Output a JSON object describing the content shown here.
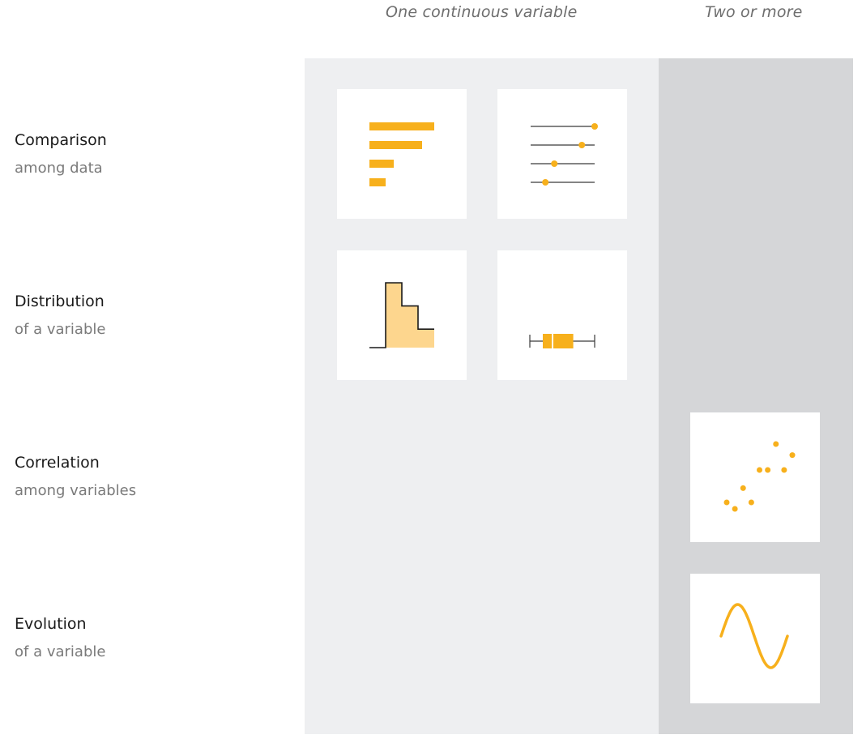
{
  "colors": {
    "accent": "#f7b01c",
    "accent_light": "#fdd68e",
    "panel_light": "#eeeff1",
    "panel_dark": "#d5d6d8",
    "line": "#3a3a3a"
  },
  "headers": {
    "col1": "One continuous variable",
    "col2": "Two or more"
  },
  "rows": [
    {
      "title": "Comparison",
      "subtitle": "among data"
    },
    {
      "title": "Distribution",
      "subtitle": "of a variable"
    },
    {
      "title": "Correlation",
      "subtitle": "among variables"
    },
    {
      "title": "Evolution",
      "subtitle": "of a variable"
    }
  ],
  "icons": {
    "bar": {
      "values": [
        80,
        65,
        30,
        20
      ],
      "max": 80
    },
    "lollipop": {
      "values": [
        100,
        80,
        37,
        23
      ]
    },
    "histogram": {
      "values": [
        0,
        70,
        45,
        20
      ]
    },
    "boxplot": {
      "min": 0,
      "q1": 20,
      "median": 35,
      "q3": 67,
      "max": 100
    },
    "scatter": {
      "points": [
        [
          0,
          0.1
        ],
        [
          1,
          0
        ],
        [
          2,
          0.32
        ],
        [
          3,
          0.1
        ],
        [
          4,
          0.6
        ],
        [
          5,
          0.6
        ],
        [
          6,
          1
        ],
        [
          7,
          0.6
        ],
        [
          8,
          0.83
        ]
      ]
    },
    "line": {
      "cycles": 1
    }
  }
}
